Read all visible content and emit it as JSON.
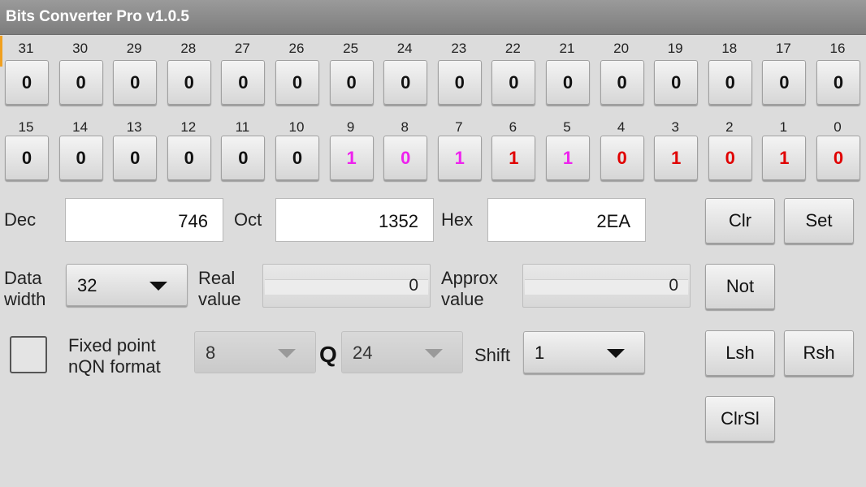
{
  "title": "Bits Converter Pro v1.0.5",
  "colors": {
    "one_magenta": "#ee22ee",
    "one_red": "#e00000",
    "zero_black": "#111111"
  },
  "bits_high": [
    {
      "index": "31",
      "value": "0"
    },
    {
      "index": "30",
      "value": "0"
    },
    {
      "index": "29",
      "value": "0"
    },
    {
      "index": "28",
      "value": "0"
    },
    {
      "index": "27",
      "value": "0"
    },
    {
      "index": "26",
      "value": "0"
    },
    {
      "index": "25",
      "value": "0"
    },
    {
      "index": "24",
      "value": "0"
    },
    {
      "index": "23",
      "value": "0"
    },
    {
      "index": "22",
      "value": "0"
    },
    {
      "index": "21",
      "value": "0"
    },
    {
      "index": "20",
      "value": "0"
    },
    {
      "index": "19",
      "value": "0"
    },
    {
      "index": "18",
      "value": "0"
    },
    {
      "index": "17",
      "value": "0"
    },
    {
      "index": "16",
      "value": "0"
    }
  ],
  "bits_low": [
    {
      "index": "15",
      "value": "0",
      "color": "#111111"
    },
    {
      "index": "14",
      "value": "0",
      "color": "#111111"
    },
    {
      "index": "13",
      "value": "0",
      "color": "#111111"
    },
    {
      "index": "12",
      "value": "0",
      "color": "#111111"
    },
    {
      "index": "11",
      "value": "0",
      "color": "#111111"
    },
    {
      "index": "10",
      "value": "0",
      "color": "#111111"
    },
    {
      "index": "9",
      "value": "1",
      "color": "#ee22ee"
    },
    {
      "index": "8",
      "value": "0",
      "color": "#ee22ee"
    },
    {
      "index": "7",
      "value": "1",
      "color": "#ee22ee"
    },
    {
      "index": "6",
      "value": "1",
      "color": "#e00000"
    },
    {
      "index": "5",
      "value": "1",
      "color": "#ee22ee"
    },
    {
      "index": "4",
      "value": "0",
      "color": "#e00000"
    },
    {
      "index": "3",
      "value": "1",
      "color": "#e00000"
    },
    {
      "index": "2",
      "value": "0",
      "color": "#e00000"
    },
    {
      "index": "1",
      "value": "1",
      "color": "#e00000"
    },
    {
      "index": "0",
      "value": "0",
      "color": "#e00000"
    }
  ],
  "dec": {
    "label": "Dec",
    "value": "746"
  },
  "oct": {
    "label": "Oct",
    "value": "1352"
  },
  "hex": {
    "label": "Hex",
    "value": "2EA"
  },
  "data_width": {
    "label_line1": "Data",
    "label_line2": "width",
    "value": "32"
  },
  "real_value": {
    "label_line1": "Real",
    "label_line2": "value",
    "value": "0"
  },
  "approx_value": {
    "label_line1": "Approx",
    "label_line2": "value",
    "value": "0"
  },
  "fixed_point": {
    "label_line1": "Fixed point",
    "label_line2": "nQN format",
    "n_value": "8",
    "q_label": "Q",
    "q_value": "24"
  },
  "shift": {
    "label": "Shift",
    "value": "1"
  },
  "buttons": {
    "clr": "Clr",
    "set": "Set",
    "not": "Not",
    "lsh": "Lsh",
    "rsh": "Rsh",
    "clrsl": "ClrSl"
  }
}
